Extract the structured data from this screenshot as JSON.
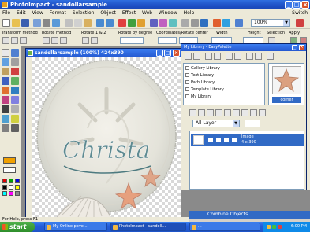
{
  "app": {
    "title": "PhotoImpact - sandollarsample",
    "switch_label": "Switch"
  },
  "menu": [
    "File",
    "Edit",
    "View",
    "Format",
    "Selection",
    "Object",
    "Effect",
    "Web",
    "Window",
    "Help"
  ],
  "toolbar": {
    "zoom_value": "100%"
  },
  "attributes": {
    "transform_method": "Transform method",
    "rotate_method": "Rotate method",
    "rotate_by": "Rotate 1 & 2",
    "rotate_by_degree": "Rotate by degree",
    "coord_label": "Coordinates/Rotate center",
    "width_label": "Width",
    "height_label": "Height",
    "selection_label": "Selection",
    "apply_label": "Apply"
  },
  "document": {
    "title": "sandollarsample (100%) 424x390",
    "canvas_text": "Christa"
  },
  "library": {
    "title": "My Library - EasyPalette",
    "tree": [
      "Gallery Library",
      "Text Library",
      "Path Library",
      "Template Library",
      "My Library"
    ],
    "thumb_label": "corner"
  },
  "layers": {
    "group_select": "All Layer",
    "row_name": "Image",
    "row_detail": "4 x 390"
  },
  "combine_bar": "Combine Objects",
  "status_bar": "For Help, press F1",
  "taskbar": {
    "start": "start",
    "tasks": [
      "My Online pove...",
      "PhotoImpact - sandoll...",
      "..."
    ],
    "clock": "6:00 PM"
  },
  "colors": {
    "titlebar": "#2458d0",
    "taskbar": "#245edb",
    "start": "#2f8f2c",
    "selection": "#316ac5",
    "text_script": "#5d8a91"
  }
}
